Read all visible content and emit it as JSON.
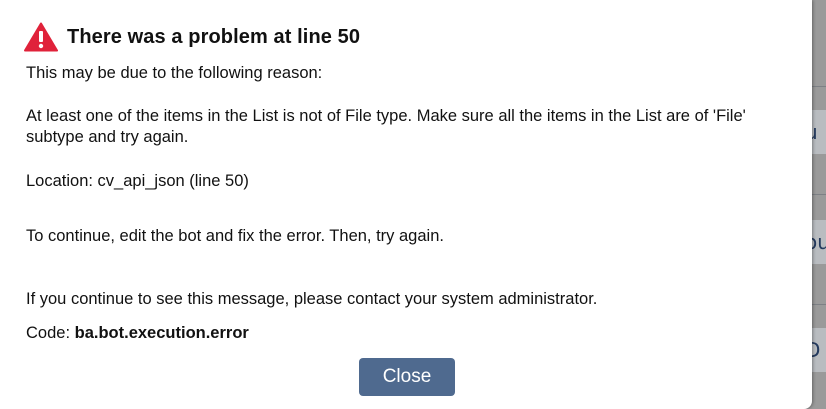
{
  "dialog": {
    "title": "There was a problem at line 50",
    "reason_intro": "This may be due to the following reason:",
    "reason_detail": "At least one of the items in the List is not of File type. Make sure all the items in the List are of 'File' subtype and try again.",
    "location": "Location: cv_api_json (line 50)",
    "continue_hint": "To continue, edit the bot and fix the error. Then, try again.",
    "contact_hint": "If you continue to see this message, please contact your system administrator.",
    "code_label": "Code: ",
    "code_value": "ba.bot.execution.error",
    "close_label": "Close",
    "icon": "warning-triangle-icon",
    "icon_color": "#e0223a",
    "button_color": "#4f6a8f"
  },
  "background": {
    "strip1_text": "u",
    "strip2_text": "ou",
    "strip3_text": "D"
  }
}
